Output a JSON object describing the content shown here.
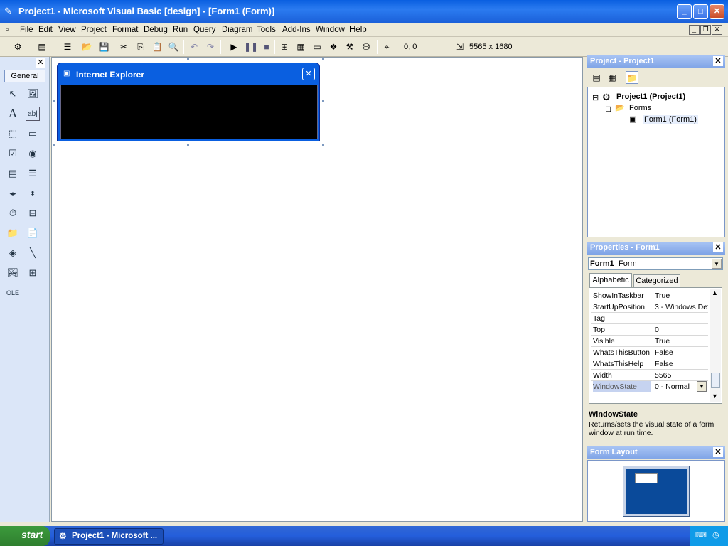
{
  "window": {
    "title": "Project1 - Microsoft Visual Basic [design] - [Form1 (Form)]"
  },
  "menu": [
    "File",
    "Edit",
    "View",
    "Project",
    "Format",
    "Debug",
    "Run",
    "Query",
    "Diagram",
    "Tools",
    "Add-Ins",
    "Window",
    "Help"
  ],
  "toolbar": {
    "position": "0, 0",
    "size": "5565 x 1680"
  },
  "toolbox": {
    "tab_label": "General"
  },
  "form": {
    "caption": "Internet Explorer"
  },
  "project_explorer": {
    "title": "Project - Project1",
    "root": "Project1 (Project1)",
    "folder": "Forms",
    "item": "Form1 (Form1)"
  },
  "properties": {
    "title": "Properties - Form1",
    "object_name": "Form1",
    "object_type": "Form",
    "tabs": [
      "Alphabetic",
      "Categorized"
    ],
    "rows": [
      {
        "name": "ShowInTaskbar",
        "value": "True"
      },
      {
        "name": "StartUpPosition",
        "value": "3 - Windows Def"
      },
      {
        "name": "Tag",
        "value": ""
      },
      {
        "name": "Top",
        "value": "0"
      },
      {
        "name": "Visible",
        "value": "True"
      },
      {
        "name": "WhatsThisButton",
        "value": "False"
      },
      {
        "name": "WhatsThisHelp",
        "value": "False"
      },
      {
        "name": "Width",
        "value": "5565"
      },
      {
        "name": "WindowState",
        "value": "0 - Normal"
      }
    ],
    "desc_title": "WindowState",
    "desc_text": "Returns/sets the visual state of a form window at run time."
  },
  "form_layout": {
    "title": "Form Layout"
  },
  "taskbar": {
    "start_label": "start",
    "task_label": "Project1 - Microsoft ..."
  }
}
